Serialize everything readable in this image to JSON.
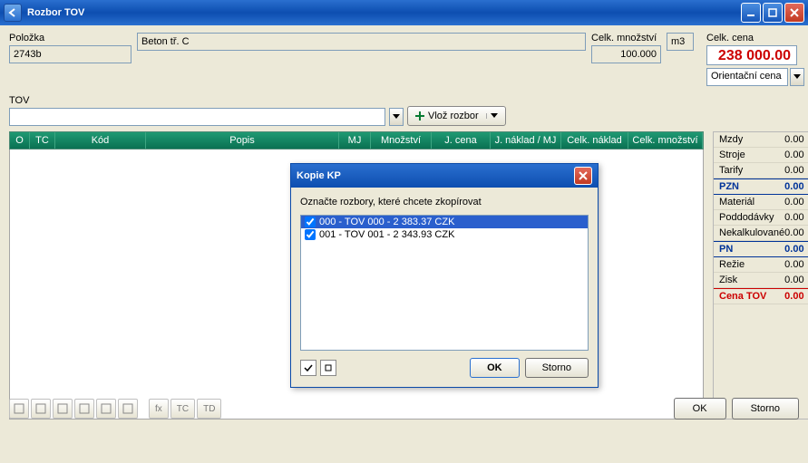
{
  "window": {
    "title": "Rozbor TOV"
  },
  "labels": {
    "polozka": "Položka",
    "celk_mnozstvi": "Celk. množství",
    "celk_cena": "Celk. cena",
    "tov": "TOV"
  },
  "polozka": {
    "code": "2743b",
    "desc": "Beton tř. C"
  },
  "qty": {
    "value": "100.000",
    "unit": "m3"
  },
  "celk_cena": "238 000.00",
  "orientacni": {
    "label": "Orientační cena"
  },
  "vloz": {
    "label": "Vlož rozbor"
  },
  "grid": {
    "headers": {
      "o": "O",
      "tc": "TC",
      "kod": "Kód",
      "popis": "Popis",
      "mj": "MJ",
      "mnoz": "Množství",
      "jc": "J. cena",
      "jn": "J. náklad / MJ",
      "cn": "Celk. náklad",
      "cm": "Celk. množství"
    }
  },
  "side": {
    "mzdy": {
      "l": "Mzdy",
      "v": "0.00"
    },
    "stroje": {
      "l": "Stroje",
      "v": "0.00"
    },
    "tarify": {
      "l": "Tarify",
      "v": "0.00"
    },
    "pzn": {
      "l": "PZN",
      "v": "0.00"
    },
    "material": {
      "l": "Materiál",
      "v": "0.00"
    },
    "poddodavky": {
      "l": "Poddodávky",
      "v": "0.00"
    },
    "nekalk": {
      "l": "Nekalkulované",
      "v": "0.00"
    },
    "pn": {
      "l": "PN",
      "v": "0.00"
    },
    "rezie": {
      "l": "Režie",
      "v": "0.00"
    },
    "zisk": {
      "l": "Zisk",
      "v": "0.00"
    },
    "cena": {
      "l": "Cena TOV",
      "v": "0.00"
    }
  },
  "bottom_btns": {
    "fx": "fx",
    "tc": "TC",
    "td": "TD"
  },
  "main_btns": {
    "ok": "OK",
    "storno": "Storno"
  },
  "modal": {
    "title": "Kopie KP",
    "instruction": "Označte rozbory, které chcete zkopírovat",
    "items": [
      {
        "text": "000 - TOV 000 - 2 383.37 CZK"
      },
      {
        "text": "001 - TOV 001 - 2 343.93 CZK"
      }
    ],
    "ok": "OK",
    "storno": "Storno"
  }
}
